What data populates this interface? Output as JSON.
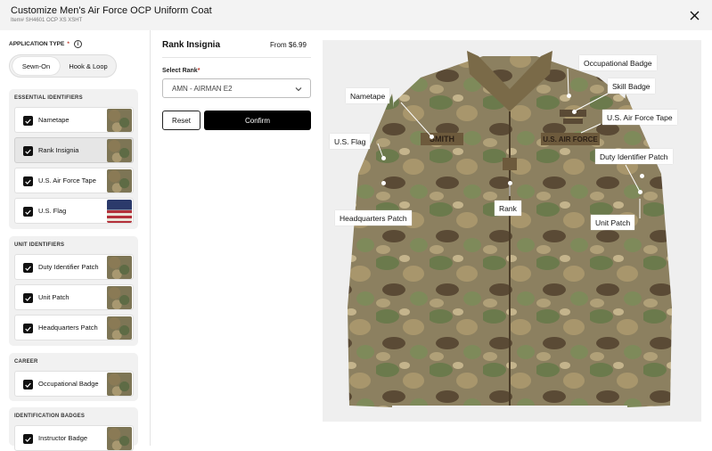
{
  "header": {
    "title": "Customize Men's Air Force OCP Uniform Coat",
    "item_line": "Item# SH4601 OCP XS XSHT"
  },
  "application_type": {
    "label": "APPLICATION TYPE",
    "required_mark": "*",
    "info_glyph": "i",
    "options": [
      "Sewn-On",
      "Hook & Loop"
    ],
    "selected": "Sewn-On"
  },
  "groups": [
    {
      "title": "ESSENTIAL IDENTIFIERS",
      "items": [
        {
          "label": "Nametape",
          "checked": true,
          "thumb": "camo"
        },
        {
          "label": "Rank Insignia",
          "checked": true,
          "thumb": "camo",
          "selected": true
        },
        {
          "label": "U.S. Air Force Tape",
          "checked": true,
          "thumb": "camo"
        },
        {
          "label": "U.S. Flag",
          "checked": true,
          "thumb": "flag"
        }
      ]
    },
    {
      "title": "UNIT IDENTIFIERS",
      "items": [
        {
          "label": "Duty Identifier Patch",
          "checked": true,
          "thumb": "camo"
        },
        {
          "label": "Unit Patch",
          "checked": true,
          "thumb": "camo"
        },
        {
          "label": "Headquarters Patch",
          "checked": true,
          "thumb": "camo"
        }
      ]
    },
    {
      "title": "CAREER",
      "items": [
        {
          "label": "Occupational Badge",
          "checked": true,
          "thumb": "camo"
        }
      ]
    },
    {
      "title": "IDENTIFICATION BADGES",
      "items": [
        {
          "label": "Instructor Badge",
          "checked": true,
          "thumb": "camo"
        }
      ]
    }
  ],
  "editor": {
    "title": "Rank Insignia",
    "price": "From $6.99",
    "select_label": "Select Rank",
    "required_mark": "*",
    "select_value": "AMN - AIRMAN E2",
    "reset_label": "Reset",
    "confirm_label": "Confirm"
  },
  "preview": {
    "jacket_nametape": "SMITH",
    "jacket_service_tape": "U.S. AIR FORCE",
    "callouts": [
      "Occupational Badge",
      "Skill Badge",
      "Nametape",
      "U.S. Air Force Tape",
      "U.S. Flag",
      "Duty Identifier Patch",
      "Headquarters Patch",
      "Rank",
      "Unit Patch"
    ]
  }
}
